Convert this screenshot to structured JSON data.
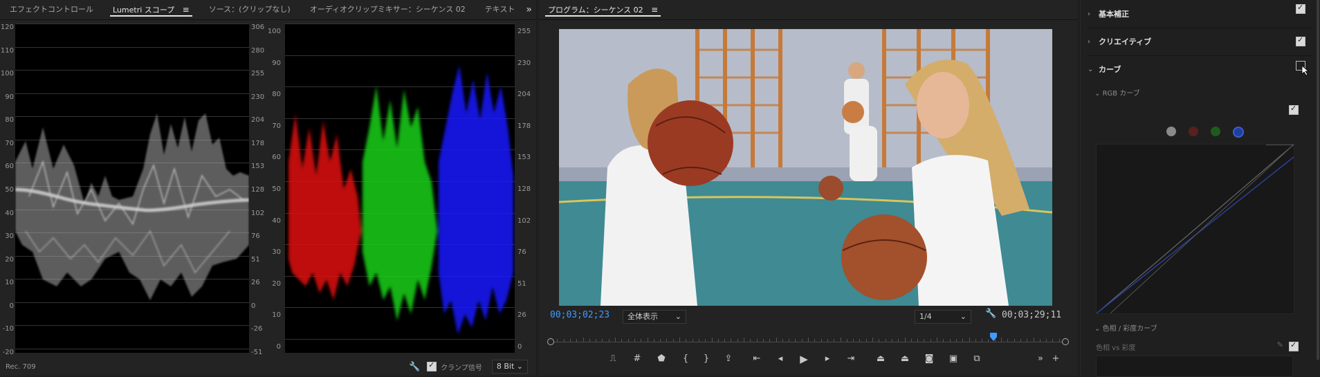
{
  "scopes_panel": {
    "tabs": [
      {
        "label": "エフェクトコントロール",
        "active": false
      },
      {
        "label": "Lumetri スコープ",
        "active": true
      },
      {
        "label": "ソース：(クリップなし)",
        "active": false
      },
      {
        "label": "オーディオクリップミキサー：シーケンス 02",
        "active": false
      },
      {
        "label": "テキスト",
        "active": false
      }
    ],
    "menu_icon": "hamburger-menu-icon",
    "overflow_icon": "double-chevron-right-icon",
    "waveform": {
      "left_axis": [
        "120",
        "110",
        "100",
        "90",
        "80",
        "70",
        "60",
        "50",
        "40",
        "30",
        "20",
        "10",
        "0",
        "-10",
        "-20"
      ],
      "right_axis": [
        "306",
        "280",
        "255",
        "230",
        "204",
        "178",
        "153",
        "128",
        "102",
        "76",
        "51",
        "26",
        "0",
        "-26",
        "-51"
      ]
    },
    "parade": {
      "left_axis": [
        "100",
        "90",
        "80",
        "70",
        "60",
        "50",
        "40",
        "30",
        "20",
        "10",
        "0"
      ],
      "right_axis": [
        "255",
        "230",
        "204",
        "178",
        "153",
        "128",
        "102",
        "76",
        "51",
        "26",
        "0"
      ],
      "colors": [
        "#e01010",
        "#10d010",
        "#1010ff"
      ]
    },
    "footer": {
      "standard": "Rec. 709",
      "wrench_icon": "wrench-icon",
      "clamp_label": "クランプ信号",
      "clamp_checked": true,
      "bit_depth": "8 Bit"
    }
  },
  "program_panel": {
    "title": "プログラム：シーケンス 02",
    "menu_icon": "hamburger-menu-icon",
    "current_time": "00;03;02;23",
    "fit": "全体表示",
    "resolution": "1/4",
    "duration": "00;03;29;11",
    "playhead_fraction": 0.86,
    "controls": [
      {
        "name": "mark-in-out-icon",
        "glyph": "⎍"
      },
      {
        "name": "safe-margins-icon",
        "glyph": "#"
      },
      {
        "name": "add-marker-icon",
        "glyph": "⬟"
      },
      {
        "name": "mark-in-icon",
        "glyph": "{"
      },
      {
        "name": "mark-out-icon",
        "glyph": "}"
      },
      {
        "name": "export-icon",
        "glyph": "⇪"
      },
      {
        "name": "go-to-in-icon",
        "glyph": "⇤"
      },
      {
        "name": "step-back-icon",
        "glyph": "◂"
      },
      {
        "name": "play-icon",
        "glyph": "▶"
      },
      {
        "name": "step-forward-icon",
        "glyph": "▸"
      },
      {
        "name": "go-to-out-icon",
        "glyph": "⇥"
      },
      {
        "name": "lift-icon",
        "glyph": "⏏"
      },
      {
        "name": "extract-icon",
        "glyph": "⏏"
      },
      {
        "name": "camera-icon",
        "glyph": "◙"
      },
      {
        "name": "compare-view-icon",
        "glyph": "▣"
      },
      {
        "name": "toggle-proxies-icon",
        "glyph": "⧉"
      },
      {
        "name": "more-controls-icon",
        "glyph": "»"
      },
      {
        "name": "add-button-icon",
        "glyph": "+"
      }
    ]
  },
  "lumetri_panel": {
    "sections": [
      {
        "label": "基本補正",
        "expanded": false,
        "checked": true
      },
      {
        "label": "クリエイティブ",
        "expanded": false,
        "checked": true
      },
      {
        "label": "カーブ",
        "expanded": true,
        "checked": false
      }
    ],
    "rgb_curve_label": "RGB カーブ",
    "rgb_curve_checked": true,
    "channel_dots": [
      "#8a8a8a",
      "#5a1f1f",
      "#1f5a1f",
      "#1f3f9f"
    ],
    "hue_sat_label": "色相 / 彩度カーブ",
    "hue_vs_sat_label": "色相 vs 彩度",
    "hue_checked": true,
    "eyedropper_icon": "eyedropper-icon"
  }
}
